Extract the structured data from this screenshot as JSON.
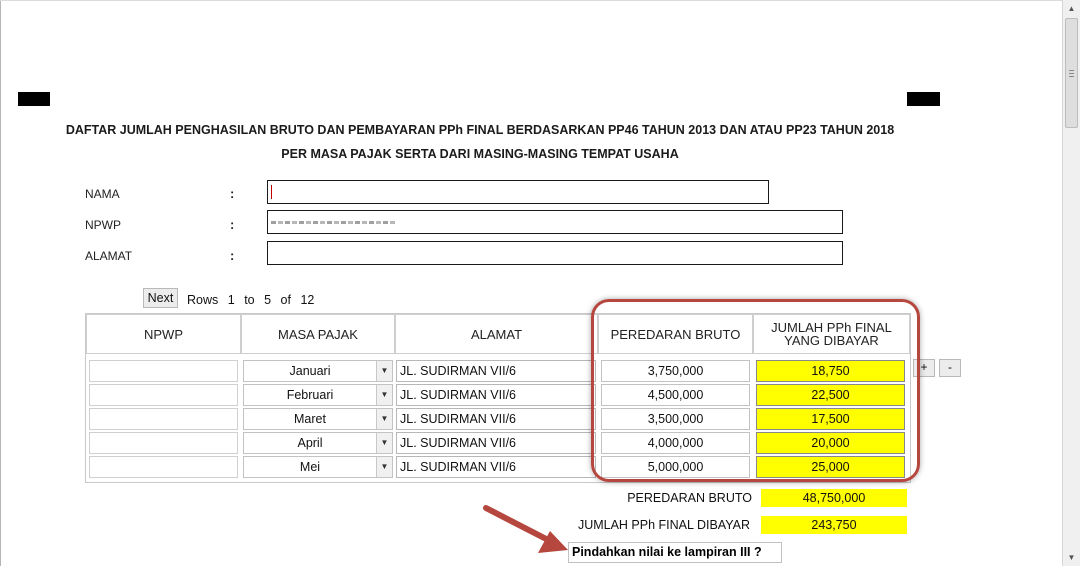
{
  "title": {
    "line1": "DAFTAR JUMLAH PENGHASILAN BRUTO DAN PEMBAYARAN PPh FINAL BERDASARKAN PP46 TAHUN 2013 DAN ATAU PP23 TAHUN 2018",
    "line2": "PER MASA PAJAK SERTA DARI MASING-MASING TEMPAT USAHA"
  },
  "form": {
    "colon": ":",
    "nama_label": "NAMA",
    "nama_value": "",
    "npwp_label": "NPWP",
    "npwp_value": "",
    "alamat_label": "ALAMAT",
    "alamat_value": ""
  },
  "pager": {
    "next_label": "Next",
    "rows_label": "Rows",
    "from": "1",
    "to_label": "to",
    "to": "5",
    "of_label": "of",
    "total": "12"
  },
  "table": {
    "headers": {
      "npwp": "NPWP",
      "masa_pajak": "MASA PAJAK",
      "alamat": "ALAMAT",
      "peredaran_bruto": "PEREDARAN BRUTO",
      "jumlah_pph": "JUMLAH PPh FINAL YANG DIBAYAR"
    },
    "rows": [
      {
        "npwp": "",
        "masa": "Januari",
        "alamat": "JL. SUDIRMAN VII/6",
        "bruto": "3,750,000",
        "pph": "18,750"
      },
      {
        "npwp": "",
        "masa": "Februari",
        "alamat": "JL. SUDIRMAN VII/6",
        "bruto": "4,500,000",
        "pph": "22,500"
      },
      {
        "npwp": "",
        "masa": "Maret",
        "alamat": "JL. SUDIRMAN VII/6",
        "bruto": "3,500,000",
        "pph": "17,500"
      },
      {
        "npwp": "",
        "masa": "April",
        "alamat": "JL. SUDIRMAN VII/6",
        "bruto": "4,000,000",
        "pph": "20,000"
      },
      {
        "npwp": "",
        "masa": "Mei",
        "alamat": "JL. SUDIRMAN VII/6",
        "bruto": "5,000,000",
        "pph": "25,000"
      }
    ],
    "add_label": "+",
    "remove_label": "-"
  },
  "summary": {
    "bruto_label": "PEREDARAN BRUTO",
    "bruto_value": "48,750,000",
    "pph_label": "JUMLAH PPh FINAL DIBAYAR",
    "pph_value": "243,750"
  },
  "transfer_button": "Pindahkan nilai ke lampiran III ?",
  "colors": {
    "highlight": "#ffff00",
    "annotation": "#b5473e"
  },
  "icons": {
    "dropdown": "chevron-down-icon",
    "scroll_up": "chevron-up-icon",
    "scroll_down": "chevron-down-icon",
    "annotation": "arrow-icon"
  }
}
